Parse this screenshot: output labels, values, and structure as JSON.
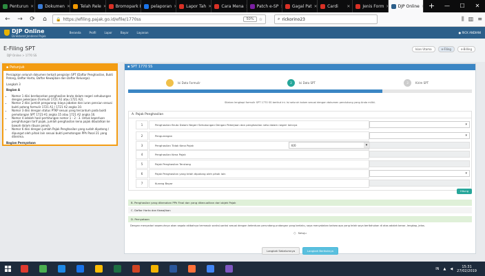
{
  "browser": {
    "tabs": [
      {
        "label": "Penturun",
        "color": "#2b8a3e"
      },
      {
        "label": "Dokumen",
        "color": "#3a7bd5"
      },
      {
        "label": "Telah Rele",
        "color": "#f29900"
      },
      {
        "label": "Bromopark Ho",
        "color": "#d93025"
      },
      {
        "label": "pelaporan",
        "color": "#1a73e8"
      },
      {
        "label": "Lapor Tah",
        "color": "#d93025"
      },
      {
        "label": "Cara Mena",
        "color": "#d93025"
      },
      {
        "label": "Patch e-SP",
        "color": "#7b1fa2"
      },
      {
        "label": "Gagal Pat",
        "color": "#d93025"
      },
      {
        "label": "Cardi",
        "color": "#d93025"
      },
      {
        "label": "Jenis Form",
        "color": "#d93025"
      },
      {
        "label": "DJP Online",
        "color": "#2c5f8a",
        "active": true
      }
    ],
    "new_tab": "+",
    "url": "https://efiling.pajak.go.id/efile/1770ss",
    "zoom": "50%",
    "search": "rickorino23",
    "window_controls": [
      "—",
      "☐",
      "✕"
    ]
  },
  "app": {
    "name": "DJP Online",
    "tagline": "Direktorat Jenderal Pajak",
    "menu": [
      "Beranda",
      "Profil",
      "Lapor",
      "Bayar",
      "Layanan"
    ],
    "user": "RICK ANDIANI"
  },
  "page": {
    "title": "E-Filing SPT",
    "breadcrumb": "DJP Online > 1770 SS",
    "steps": [
      "Isian Utama",
      "e-Filing",
      "e-Billing"
    ],
    "active_step": 1
  },
  "petunjuk": {
    "title": "Petunjuk",
    "intro": "Persiapkan seluruh dokumen terkait pengisian SPT (Daftar Penghasilan, Bukti Potong, Daftar Harta, Daftar Kewajiban dan Daftar Keluarga).",
    "step_label": "Langkah 3",
    "section_a": "Bagian A",
    "items": [
      "Nomor 1 diisi berdasarkan penghasilan bruto dalam negeri sehubungan dengan pekerjaan (Formulir 1721 A1 atau 1721 A2).",
      "Nomor 2 diisi jumlah pengurang: biaya jabatan dan iuran pensiun sesuai bukti potong formulir 1721 A1 / 1721 A2 angka 10.",
      "Nomor 3 diisi dengan status PTKP sesuai yang tercantum pada bukti pemotongan SPT 1721-A1 angka 15 atau 1721 A2 angka 16.",
      "Nomor 4 adalah hasil perhitungan nomor 1 - 2 - 3. Untuk keperluan penghitungan tarif pajak, jumlah penghasilan kena pajak dibulatkan ke bawah dalam ribuan penuh.",
      "Nomor 6 diisi dengan jumlah Pajak Penghasilan yang sudah dipotong / dipungut oleh pihak lain sesuai bukti pemotongan PPh Pasal 21 yang diterima."
    ],
    "section_b": "Bagian Pernyataan"
  },
  "spt": {
    "title": "SPT 1770 SS",
    "wizard": [
      {
        "num": "1",
        "label": "Isi Data Formulir",
        "color": "#f0c04a"
      },
      {
        "num": "2",
        "label": "Isi Data SPT",
        "color": "#26a69a"
      },
      {
        "num": "3",
        "label": "Kirim SPT",
        "color": "#cccccc"
      }
    ],
    "progress_pct": 74,
    "notice": "Silakan lengkapi formulir SPT 1770 SS berikut ini. Isi seluruh kolom sesuai dengan dokumen pendukung yang Anda miliki.",
    "section_a_title": "A. Pajak Penghasilan",
    "rows": [
      {
        "num": "1",
        "label": "Penghasilan Bruto Dalam Negeri Sehubungan Dengan Pekerjaan dan penghasilan neto dalam negeri lainnya",
        "value": "",
        "type": "select"
      },
      {
        "num": "2",
        "label": "Pengurangan",
        "value": "",
        "type": "select"
      },
      {
        "num": "3",
        "label": "Penghasilan Tidak Kena Pajak",
        "value": "",
        "type": "ro",
        "mid_select": "K/0"
      },
      {
        "num": "4",
        "label": "Penghasilan Kena Pajak",
        "value": "",
        "type": "ro"
      },
      {
        "num": "5",
        "label": "Pajak Penghasilan Terutang",
        "value": "",
        "type": "ro"
      },
      {
        "num": "6",
        "label": "Pajak Penghasilan yang telah dipotong oleh pihak lain",
        "value": "",
        "type": "select"
      },
      {
        "num": "7",
        "label": "Kurang Bayar",
        "value": "",
        "type": "ro"
      }
    ],
    "calc_button": "Hitung",
    "section_b_bar": "B. Penghasilan yang dikenakan PPh Final dan yang dikecualikan dari objek Pajak",
    "section_c_bar": "C. Daftar Harta dan Kewajiban",
    "section_d_bar": "D. Pernyataan",
    "statement": "Dengan menyadari sepenuhnya akan segala akibatnya termasuk sanksi-sanksi sesuai dengan ketentuan perundang-undangan yang berlaku, saya menyatakan bahwa apa yang telah saya beritahukan di atas adalah benar, lengkap, jelas.",
    "statement_option": "Setuju",
    "btn_prev": "Langkah Sebelumnya",
    "btn_next": "Langkah Berikutnya"
  },
  "taskbar": {
    "apps": [
      "#e03a2f",
      "#4caf50",
      "#1e88e5",
      "#1a73e8",
      "#fbbc05",
      "#1d6f42",
      "#d04423",
      "#f4b400",
      "#2b579a",
      "#ff7139",
      "#4285f4",
      "#7e57c2"
    ],
    "lang": "IN",
    "time": "15:31",
    "date": "27/02/2019"
  }
}
